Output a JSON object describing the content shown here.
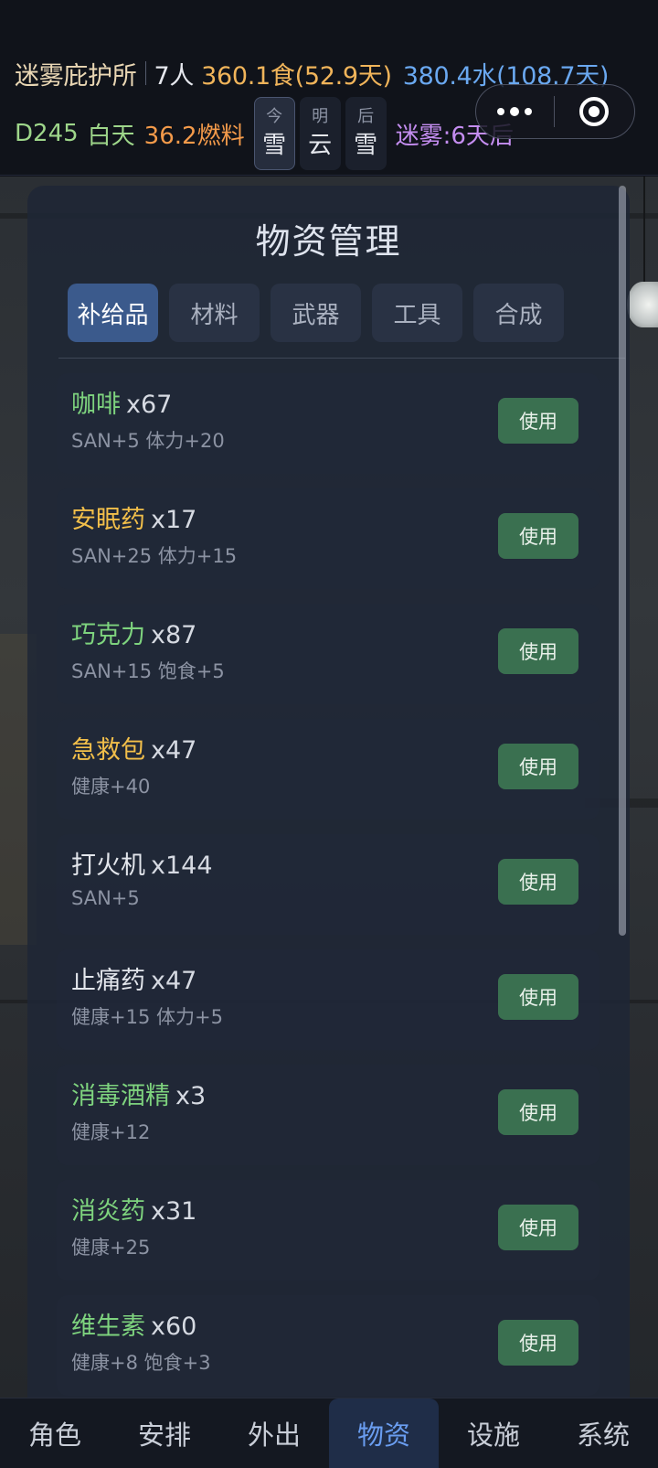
{
  "header": {
    "shelter_name": "迷雾庇护所",
    "people": "7人",
    "food": "360.1食(52.9天)",
    "water": "380.4水(108.7天)",
    "day": "D245",
    "daytime": "白天",
    "fuel": "36.2燃料",
    "weather": [
      {
        "label": "今",
        "value": "雪"
      },
      {
        "label": "明",
        "value": "云"
      },
      {
        "label": "后",
        "value": "雪"
      }
    ],
    "fog": "迷雾:6天后"
  },
  "capsule": {
    "more_icon": "more-dots-icon",
    "close_icon": "target-icon"
  },
  "panel": {
    "title": "物资管理",
    "tabs": [
      "补给品",
      "材料",
      "武器",
      "工具",
      "合成"
    ],
    "active_tab": 0
  },
  "items": [
    {
      "name": "咖啡",
      "qty": "x67",
      "effect": "SAN+5 体力+20",
      "color": "#7ed37e",
      "button": "使用"
    },
    {
      "name": "安眠药",
      "qty": "x17",
      "effect": "SAN+25 体力+15",
      "color": "#f2bf4a",
      "button": "使用"
    },
    {
      "name": "巧克力",
      "qty": "x87",
      "effect": "SAN+15 饱食+5",
      "color": "#7ed37e",
      "button": "使用"
    },
    {
      "name": "急救包",
      "qty": "x47",
      "effect": "健康+40",
      "color": "#f2bf4a",
      "button": "使用"
    },
    {
      "name": "打火机",
      "qty": "x144",
      "effect": "SAN+5",
      "color": "#e3e6ec",
      "button": "使用"
    },
    {
      "name": "止痛药",
      "qty": "x47",
      "effect": "健康+15 体力+5",
      "color": "#e3e6ec",
      "button": "使用"
    },
    {
      "name": "消毒酒精",
      "qty": "x3",
      "effect": "健康+12",
      "color": "#7ed37e",
      "button": "使用"
    },
    {
      "name": "消炎药",
      "qty": "x31",
      "effect": "健康+25",
      "color": "#7ed37e",
      "button": "使用"
    },
    {
      "name": "维生素",
      "qty": "x60",
      "effect": "健康+8 饱食+3",
      "color": "#7ed37e",
      "button": "使用"
    }
  ],
  "bottom_nav": {
    "items": [
      "角色",
      "安排",
      "外出",
      "物资",
      "设施",
      "系统"
    ],
    "active": 3
  }
}
